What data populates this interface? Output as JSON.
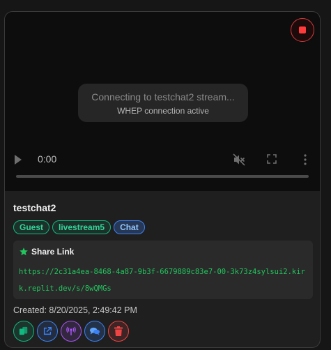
{
  "video": {
    "status_title": "Connecting to testchat2 stream...",
    "status_subtitle": "WHEP connection active",
    "time": "0:00",
    "progress": 0
  },
  "stream": {
    "name": "testchat2",
    "tags": [
      "Guest",
      "livestream5",
      "Chat"
    ]
  },
  "share": {
    "heading": "Share Link",
    "url": "https://2c31a4ea-8468-4a87-9b3f-6679889c83e7-00-3k73z4sylsui2.kirk.replit.dev/s/8wQMGs"
  },
  "created": "Created: 8/20/2025, 2:49:42 PM",
  "actions": [
    {
      "icon": "copy-icon",
      "color": "#10b981"
    },
    {
      "icon": "external-link-icon",
      "color": "#3b82f6"
    },
    {
      "icon": "broadcast-icon",
      "color": "#a855f7"
    },
    {
      "icon": "chat-icon",
      "color": "#3b82f6"
    },
    {
      "icon": "trash-icon",
      "color": "#ef4444"
    }
  ],
  "colors": {
    "stop_red": "#ff3b3b",
    "tag_green": "#34d399",
    "tag_blue": "#93c5fd",
    "url_green": "#22c55e"
  }
}
